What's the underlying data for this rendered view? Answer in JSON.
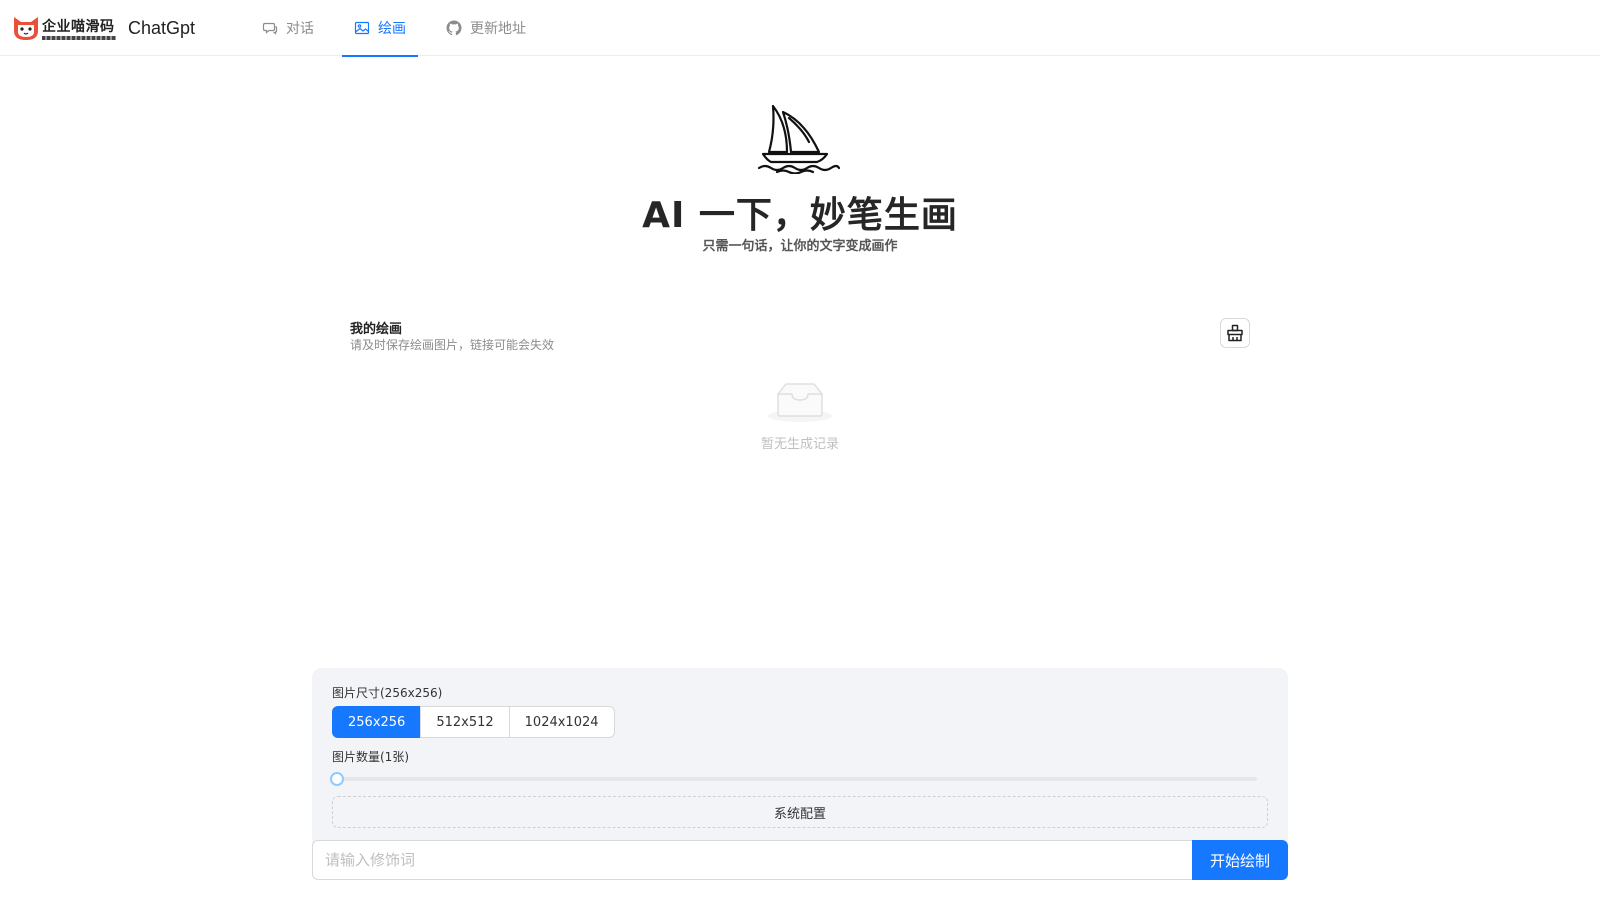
{
  "header": {
    "logo_text": "企业喵滑码",
    "app_name": "ChatGpt",
    "nav": [
      {
        "label": "对话",
        "icon": "chat-icon",
        "active": false
      },
      {
        "label": "绘画",
        "icon": "picture-icon",
        "active": true
      },
      {
        "label": "更新地址",
        "icon": "github-icon",
        "active": false
      }
    ]
  },
  "hero": {
    "icon": "sailboat-icon",
    "title": "AI 一下，妙笔生画",
    "subtitle": "只需一句话，让你的文字变成画作"
  },
  "gallery": {
    "title": "我的绘画",
    "description": "请及时保存绘画图片，链接可能会失效",
    "clear_icon": "broom-icon",
    "empty_text": "暂无生成记录"
  },
  "settings": {
    "size_label": "图片尺寸(256x256)",
    "sizes": [
      "256x256",
      "512x512",
      "1024x1024"
    ],
    "selected_size": "256x256",
    "count_label": "图片数量(1张)",
    "count_value": 1,
    "system_config_label": "系统配置"
  },
  "prompt": {
    "placeholder": "请输入修饰词",
    "value": "",
    "submit_label": "开始绘制"
  },
  "colors": {
    "accent": "#1677ff",
    "panel_bg": "#f3f4f7"
  }
}
